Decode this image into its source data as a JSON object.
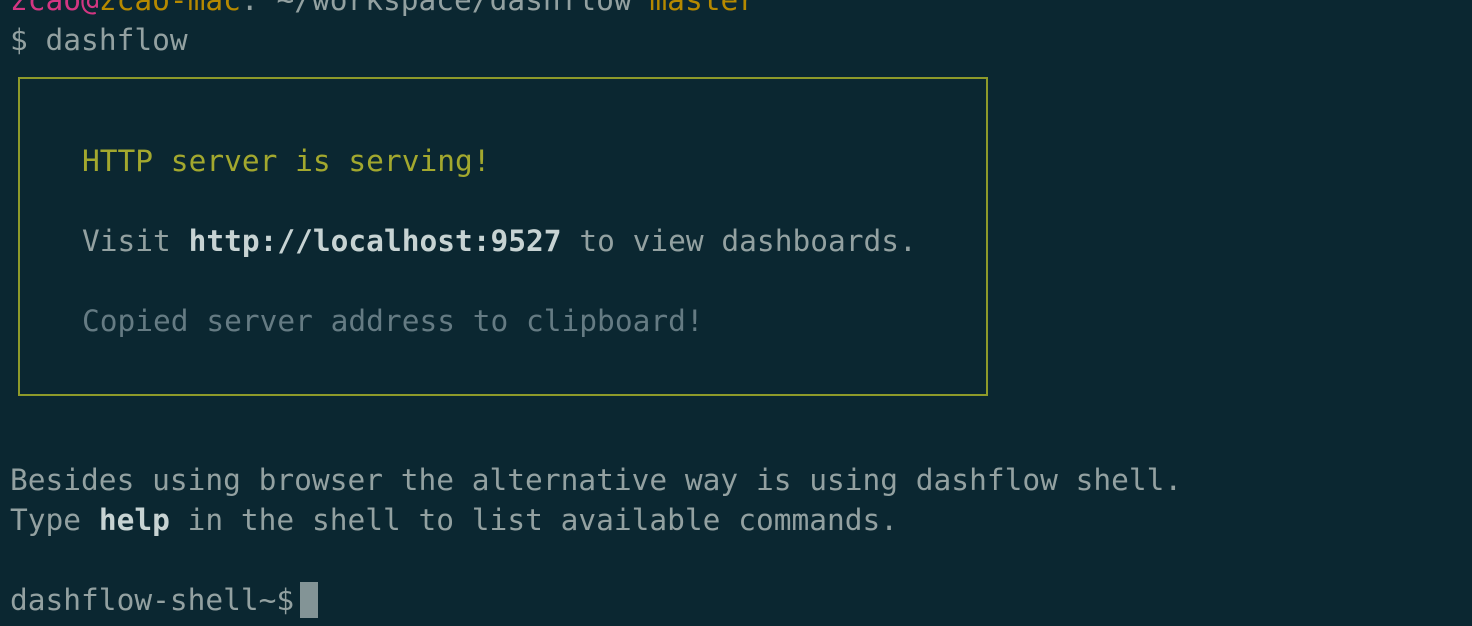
{
  "prompt": {
    "user": "zcao",
    "at": "@",
    "host": "zcao-mac",
    "separator": ":",
    "path": "~/workspace/dashflow",
    "branch": "master"
  },
  "command": {
    "symbol": "$",
    "text": "dashflow"
  },
  "box": {
    "serving": "HTTP server is serving!",
    "visit_prefix": "Visit",
    "visit_url": "http://localhost:9527",
    "visit_suffix": "to view dashboards.",
    "copied": "Copied server address to clipboard!"
  },
  "messages": {
    "line1": "Besides using browser the alternative way is using dashflow shell.",
    "line2_prefix": "Type",
    "line2_keyword": "help",
    "line2_suffix": "in the shell to list available commands."
  },
  "shell": {
    "prompt": "dashflow-shell~$"
  },
  "colors": {
    "background": "#0b2731",
    "user": "#d33682",
    "host": "#b58900",
    "border": "#8e9a2a",
    "serving": "#a3a82e",
    "text": "#93a1a1",
    "dim": "#657b83"
  }
}
